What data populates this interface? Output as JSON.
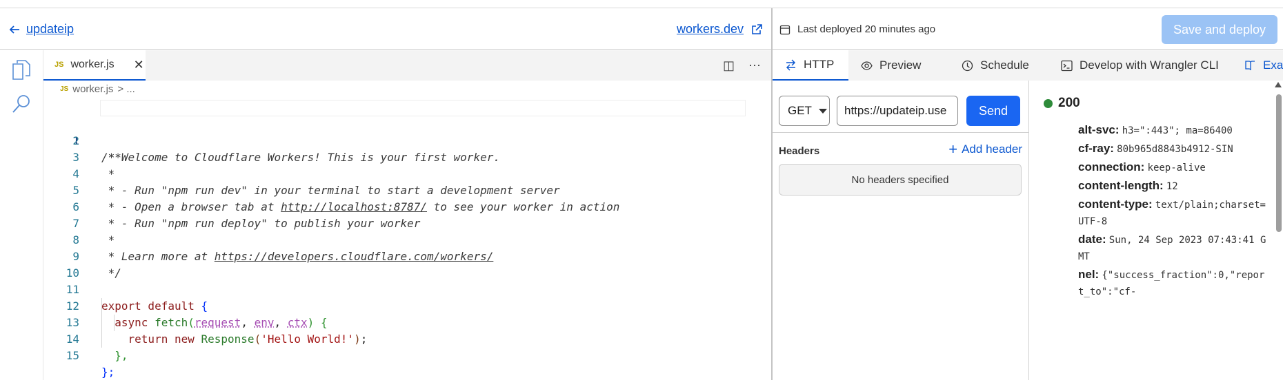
{
  "left_header": {
    "back_label": "updateip",
    "workers_link": "workers.dev"
  },
  "editor": {
    "tab_badge": "JS",
    "tab_label": "worker.js",
    "breadcrumb_badge": "JS",
    "breadcrumb_file": "worker.js",
    "breadcrumb_rest": "> ..."
  },
  "code_lines": [
    {
      "n": "1",
      "text": "/**"
    },
    {
      "n": "2",
      "text": " * Welcome to Cloudflare Workers! This is your first worker."
    },
    {
      "n": "3",
      "text": " *"
    },
    {
      "n": "4",
      "text": " * - Run \"npm run dev\" in your terminal to start a development server"
    },
    {
      "n": "5",
      "pre": " * - Open a browser tab at ",
      "url": "http://localhost:8787/",
      "post": " to see your worker in action"
    },
    {
      "n": "6",
      "text": " * - Run \"npm run deploy\" to publish your worker"
    },
    {
      "n": "7",
      "text": " *"
    },
    {
      "n": "8",
      "pre": " * Learn more at ",
      "url": "https://developers.cloudflare.com/workers/",
      "post": ""
    },
    {
      "n": "9",
      "text": " */"
    },
    {
      "n": "10",
      "text": ""
    },
    {
      "n": "11",
      "kw": "export default",
      "brace": "{"
    },
    {
      "n": "12",
      "kw": "async",
      "fn": "fetch",
      "p1": "request",
      "p2": "env",
      "p3": "ctx",
      "brace": "{"
    },
    {
      "n": "13",
      "kw": "return new",
      "fn": "Response",
      "str": "'Hello World!'"
    },
    {
      "n": "14",
      "text": "},"
    },
    {
      "n": "15",
      "text": "};"
    }
  ],
  "right_header": {
    "deployed": "Last deployed 20 minutes ago",
    "save_button": "Save and deploy"
  },
  "right_tabs": [
    "HTTP",
    "Preview",
    "Schedule",
    "Develop with Wrangler CLI",
    "Exampl"
  ],
  "request": {
    "method": "GET",
    "url": "https://updateip.use",
    "send": "Send",
    "headers_title": "Headers",
    "add_header": "Add header",
    "no_headers": "No headers specified"
  },
  "response": {
    "status": "200",
    "headers": [
      {
        "k": "alt-svc:",
        "v": "h3=\":443\"; ma=86400"
      },
      {
        "k": "cf-ray:",
        "v": "80b965d8843b4912-SIN"
      },
      {
        "k": "connection:",
        "v": "keep-alive"
      },
      {
        "k": "content-length:",
        "v": "12"
      },
      {
        "k": "content-type:",
        "v": "text/plain;charset=UTF-8"
      },
      {
        "k": "date:",
        "v": "Sun, 24 Sep 2023 07:43:41 GMT"
      },
      {
        "k": "nel:",
        "v": "{\"success_fraction\":0,\"report_to\":\"cf-"
      }
    ]
  },
  "colors": {
    "accent": "#0b57d0",
    "status_ok": "#2e8b3a",
    "save_disabled": "#9bc3f5"
  }
}
